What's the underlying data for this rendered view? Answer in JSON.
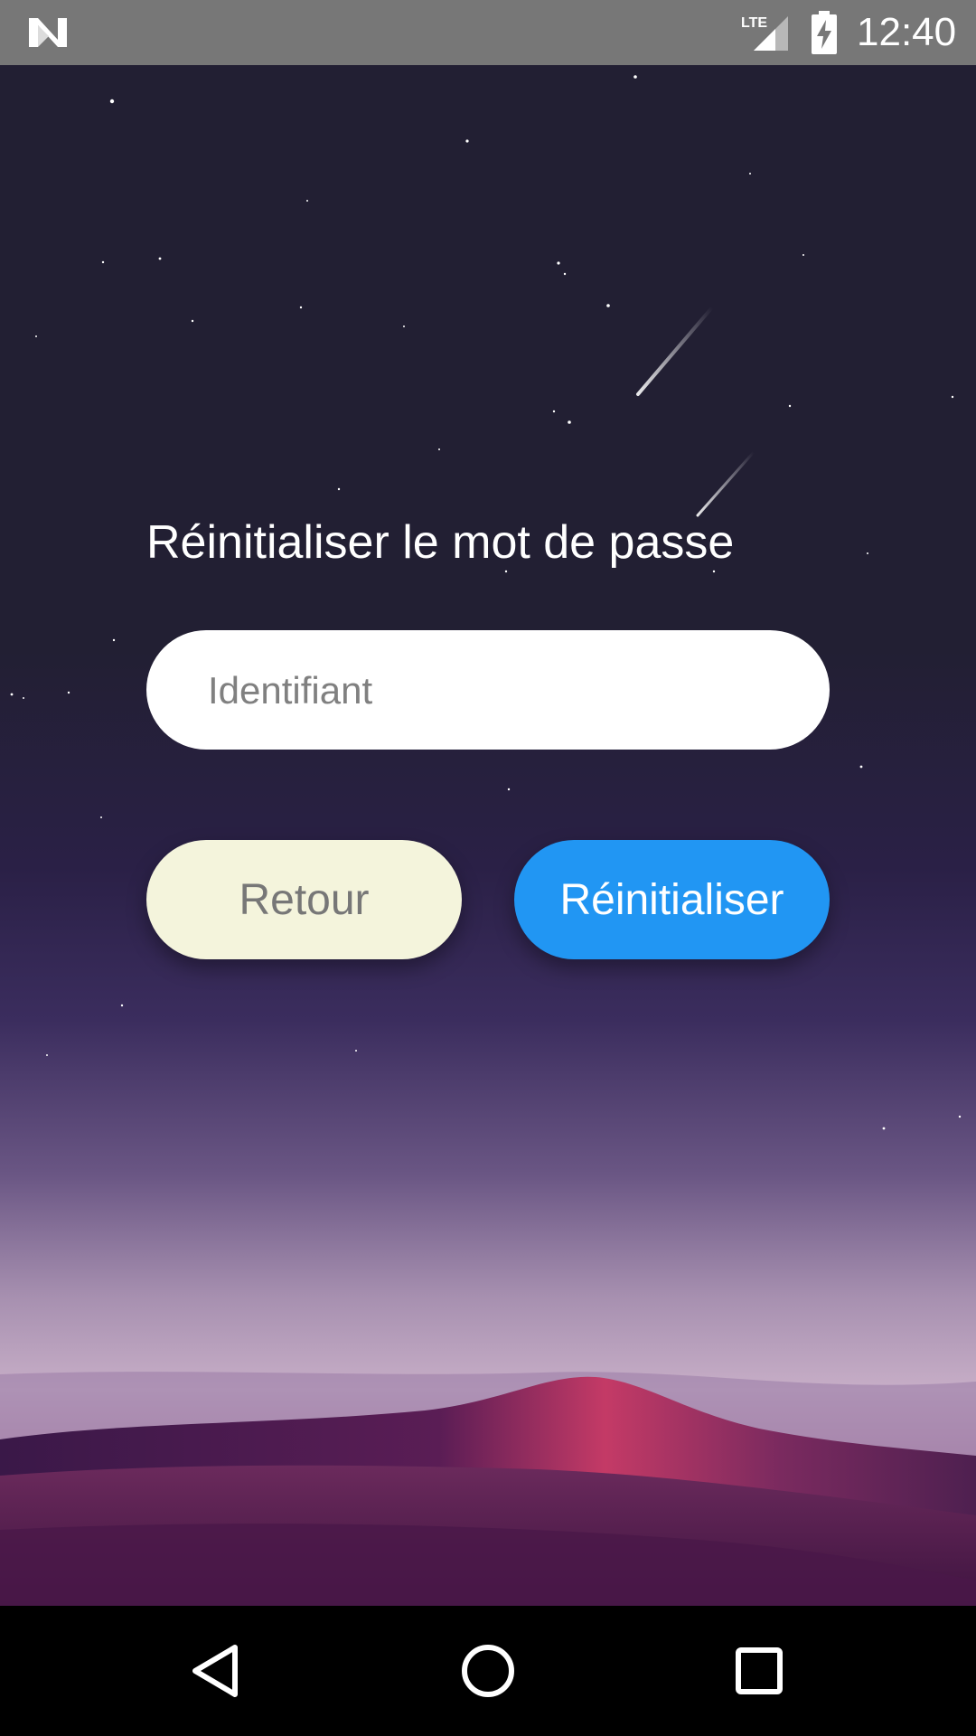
{
  "status_bar": {
    "time": "12:40",
    "network": "LTE",
    "icons": [
      "n-logo-icon",
      "lte-signal-icon",
      "battery-charging-icon"
    ]
  },
  "form": {
    "title": "Réinitialiser le mot de passe",
    "identifier_placeholder": "Identifiant",
    "identifier_value": "",
    "back_label": "Retour",
    "reset_label": "Réinitialiser"
  },
  "colors": {
    "status_bar": "#777777",
    "background_top": "#221f33",
    "back_button": "#f4f4dc",
    "reset_button": "#2196f3",
    "nav_bar": "#000000"
  },
  "nav_bar": {
    "icons": [
      "back-triangle-icon",
      "home-circle-icon",
      "recents-square-icon"
    ]
  }
}
